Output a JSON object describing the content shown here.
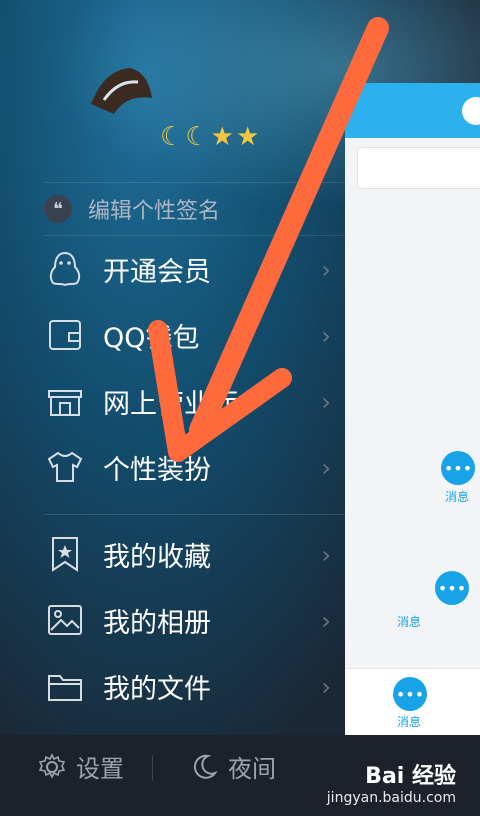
{
  "profile": {
    "badges": [
      "☾",
      "☾",
      "★",
      "★"
    ],
    "signature_placeholder": "编辑个性签名"
  },
  "menu": {
    "items": [
      {
        "label": "开通会员",
        "icon": "penguin-icon"
      },
      {
        "label": "QQ钱包",
        "icon": "wallet-icon"
      },
      {
        "label": "网上营业厅",
        "icon": "store-icon"
      },
      {
        "label": "个性装扮",
        "icon": "tshirt-icon"
      }
    ],
    "items2": [
      {
        "label": "我的收藏",
        "icon": "bookmark-star-icon"
      },
      {
        "label": "我的相册",
        "icon": "photo-icon"
      },
      {
        "label": "我的文件",
        "icon": "folder-icon"
      }
    ]
  },
  "footer": {
    "settings_label": "设置",
    "night_label": "夜间"
  },
  "panel": {
    "msg_label_1": "消息",
    "msg_label_2": "消息",
    "msg_label_bottom": "消息"
  },
  "watermark": {
    "brand": "Bai 经验",
    "url": "jingyan.baidu.com"
  },
  "colors": {
    "accent": "#2bb1ee",
    "annotation_arrow": "#ff6a3d",
    "drawer_bg": "#1c212a"
  }
}
